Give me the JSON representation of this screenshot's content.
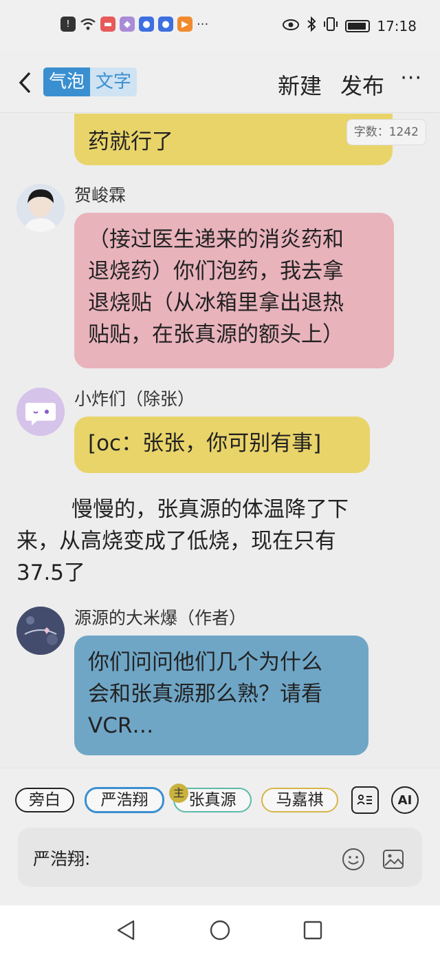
{
  "status_bar": {
    "time": "17:18",
    "left_icons": [
      "alert-icon",
      "wifi-icon",
      "app-icon-red",
      "app-icon-purple",
      "app-icon-paw",
      "app-icon-paw",
      "app-icon-orange",
      "more-dots-icon"
    ],
    "more": "···"
  },
  "header": {
    "tab_bubble": "气泡",
    "tab_text": "文字",
    "new_label": "新建",
    "publish_label": "发布",
    "more_label": "···"
  },
  "chat": {
    "word_count": "字数：1242",
    "messages": [
      {
        "text_lines": [
          "药就行了"
        ],
        "color": "#e9d46a"
      },
      {
        "name": "贺峻霖",
        "text_lines": [
          "（接过医生递来的消炎药和",
          "退烧药）你们泡药，我去拿",
          "退烧贴（从冰箱里拿出退热",
          "贴贴，在张真源的额头上）"
        ],
        "color": "#e9b3bc"
      },
      {
        "name": "小炸们（除张）",
        "text_lines": [
          "[oc：张张，你可别有事]"
        ],
        "color": "#e9d46a"
      },
      {
        "name": "源源的大米爆（作者）",
        "text_lines": [
          "你们问问他们几个为什么",
          "会和张真源那么熟？请看",
          "VCR…"
        ],
        "color": "#6fa6c6"
      }
    ],
    "narration_lines": [
      "慢慢的，张真源的体温降了下",
      "来，从高烧变成了低烧，现在只有",
      "37.5了"
    ]
  },
  "roles": {
    "chips": [
      "旁白",
      "严浩翔",
      "张真源",
      "马嘉祺"
    ],
    "main_badge": "主",
    "ai_label": "AI"
  },
  "input": {
    "prefix": "严浩翔:"
  },
  "colors": {
    "accent": "#3a8fd0",
    "yellow_bubble": "#e9d46a",
    "pink_bubble": "#e9b3bc",
    "blue_bubble": "#6fa6c6"
  }
}
